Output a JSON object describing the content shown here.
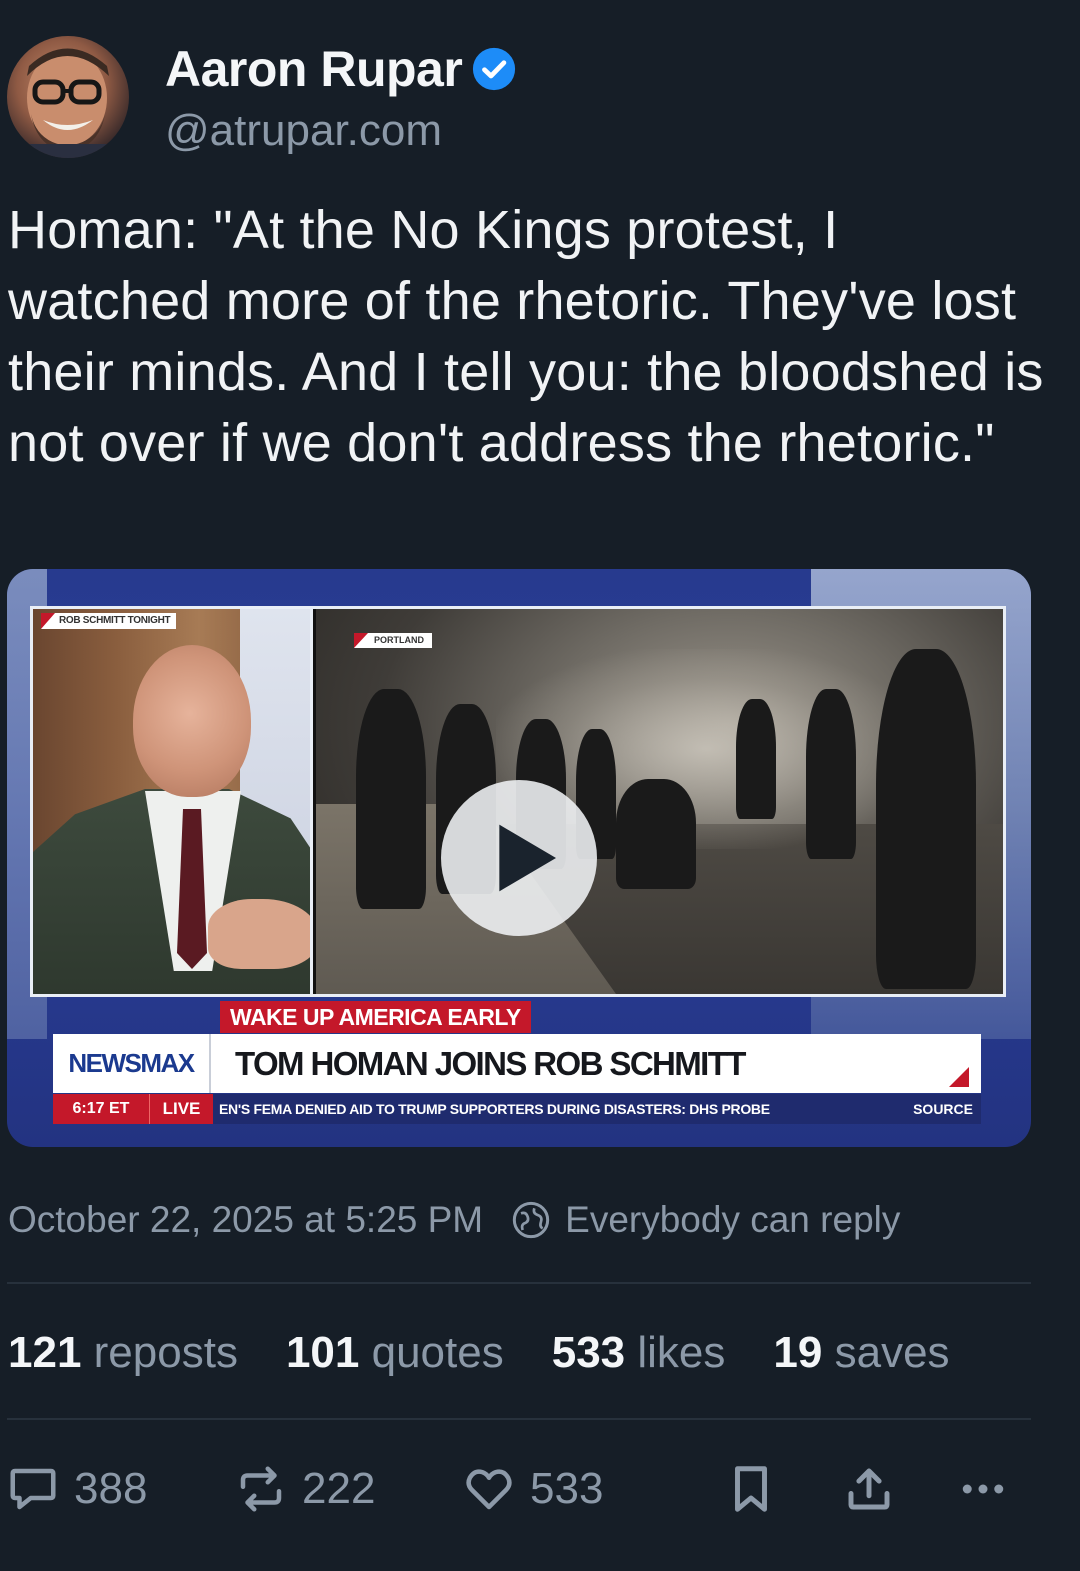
{
  "author": {
    "display_name": "Aaron Rupar",
    "handle": "@atrupar.com",
    "verified": true,
    "avatar_icon": "avatar-photo"
  },
  "post": {
    "text": "Homan: \"At the No Kings protest, I watched more of the rhetoric. They've lost their minds. And I tell you: the bloodshed is not over if we don't address the rhetoric.\""
  },
  "video": {
    "show_tag": "ROB SCHMITT TONIGHT",
    "location_tag": "PORTLAND",
    "program": "WAKE UP AMERICA EARLY",
    "network": "NEWSMAX",
    "headline": "TOM HOMAN JOINS ROB SCHMITT",
    "time": "6:17 ET",
    "live": "LIVE",
    "ticker": "EN'S FEMA DENIED AID TO TRUMP SUPPORTERS DURING DISASTERS: DHS PROBE",
    "source": "SOURCE",
    "play_icon": "play-icon",
    "accent_red": "#c4182a",
    "network_blue": "#1b3a8f"
  },
  "meta": {
    "timestamp": "October 22, 2025 at 5:25 PM",
    "reply_setting": "Everybody can reply",
    "reply_icon": "globe-icon"
  },
  "stats": [
    {
      "count": "121",
      "label": "reposts"
    },
    {
      "count": "101",
      "label": "quotes"
    },
    {
      "count": "533",
      "label": "likes"
    },
    {
      "count": "19",
      "label": "saves"
    }
  ],
  "actions": {
    "reply_count": "388",
    "repost_count": "222",
    "like_count": "533",
    "icons": [
      "comment-icon",
      "repost-icon",
      "heart-icon",
      "bookmark-icon",
      "share-icon",
      "more-icon"
    ]
  },
  "colors": {
    "background": "#161e27",
    "muted_text": "#8c99a8",
    "verified_blue": "#1d8cf8"
  }
}
